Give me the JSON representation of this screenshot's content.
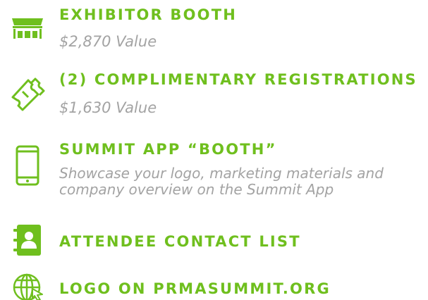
{
  "colors": {
    "accent": "#6fbf1e",
    "muted": "#a3a3a3"
  },
  "items": [
    {
      "icon": "booth-icon",
      "title": "EXHIBITOR BOOTH",
      "subtitle": "$2,870 Value"
    },
    {
      "icon": "tickets-icon",
      "title": "(2) COMPLIMENTARY REGISTRATIONS",
      "subtitle": "$1,630 Value"
    },
    {
      "icon": "smartphone-icon",
      "title": "SUMMIT APP “BOOTH”",
      "description_line1": "Showcase your logo, marketing materials and",
      "description_line2": "company overview on the Summit App"
    },
    {
      "icon": "contact-book-icon",
      "title": "ATTENDEE CONTACT LIST"
    },
    {
      "icon": "globe-icon",
      "title": "LOGO ON PRMASUMMIT.ORG"
    }
  ]
}
